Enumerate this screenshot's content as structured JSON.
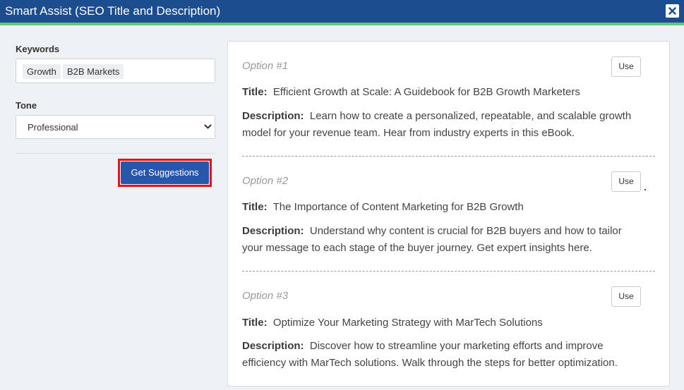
{
  "window": {
    "title": "Smart Assist (SEO Title and Description)",
    "close_icon": "close-icon"
  },
  "colors": {
    "titlebar": "#1c4d8f",
    "accent_strip": "#6cc27a",
    "primary_button": "#2557ac",
    "highlight_outline": "#e3131b"
  },
  "keywords": {
    "label": "Keywords",
    "tags": [
      "Growth",
      "B2B Markets"
    ]
  },
  "tone": {
    "label": "Tone",
    "selected": "Professional"
  },
  "actions": {
    "get_suggestions_label": "Get Suggestions"
  },
  "options": [
    {
      "heading": "Option #1",
      "use_label": "Use",
      "title_label": "Title:",
      "title": "Efficient Growth at Scale: A Guidebook for B2B Growth Marketers",
      "description_label": "Description:",
      "description_line1": "Learn how to create a personalized, repeatable, and scalable growth",
      "description_line2": "model for your revenue team. Hear from industry experts in this eBook."
    },
    {
      "heading": "Option #2",
      "use_label": "Use",
      "title_label": "Title:",
      "title": "The Importance of Content Marketing for B2B Growth",
      "description_label": "Description:",
      "description_line1": "Understand why content is crucial for B2B buyers and how to tailor",
      "description_line2": "your message to each stage of the buyer journey. Get expert insights here."
    },
    {
      "heading": "Option #3",
      "use_label": "Use",
      "title_label": "Title:",
      "title": "Optimize Your Marketing Strategy with MarTech Solutions",
      "description_label": "Description:",
      "description_line1": "Discover how to streamline your marketing efforts and improve",
      "description_line2": "efficiency with MarTech solutions. Walk through the steps for better optimization."
    }
  ]
}
